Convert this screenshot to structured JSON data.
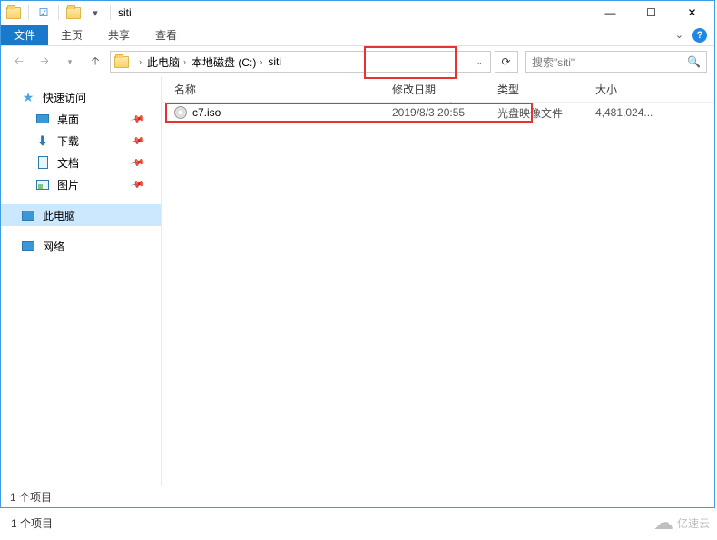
{
  "title": "siti",
  "ribbon": {
    "file": "文件",
    "home": "主页",
    "share": "共享",
    "view": "查看"
  },
  "breadcrumbs": [
    "此电脑",
    "本地磁盘 (C:)",
    "siti"
  ],
  "search_placeholder": "搜索\"siti\"",
  "nav": {
    "quick": "快速访问",
    "desktop": "桌面",
    "downloads": "下载",
    "documents": "文档",
    "pictures": "图片",
    "thispc": "此电脑",
    "network": "网络"
  },
  "columns": {
    "name": "名称",
    "date": "修改日期",
    "type": "类型",
    "size": "大小"
  },
  "files": [
    {
      "name": "c7.iso",
      "date": "2019/8/3 20:55",
      "type": "光盘映像文件",
      "size": "4,481,024..."
    }
  ],
  "status": "1 个项目",
  "watermark": "亿速云"
}
